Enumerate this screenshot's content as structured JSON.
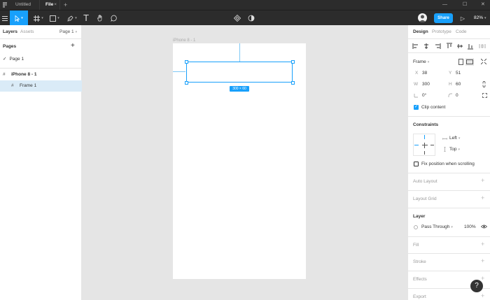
{
  "titlebar": {
    "tabs": [
      {
        "label": "Untitled"
      },
      {
        "label": "File",
        "close": "×"
      }
    ],
    "new_tab": "+",
    "window_controls": {
      "minimize": "—",
      "maximize": "☐",
      "close": "✕"
    }
  },
  "toolbar": {
    "text_tool": "T",
    "share_label": "Share",
    "zoom_label": "82%",
    "play_icon": "▷"
  },
  "left_panel": {
    "tabs": {
      "layers": "Layers",
      "assets": "Assets"
    },
    "page_selector": "Page 1",
    "pages_header": "Pages",
    "add_page": "+",
    "pages": [
      {
        "label": "Page 1",
        "check": "✓"
      }
    ],
    "layers": [
      {
        "label": "iPhone 8 - 1",
        "icon": "#"
      },
      {
        "label": "Frame 1",
        "icon": "#"
      }
    ]
  },
  "canvas": {
    "artboard_label": "iPhone 8 - 1",
    "size_badge": "300 × 60"
  },
  "right_panel": {
    "tabs": {
      "design": "Design",
      "prototype": "Prototype",
      "code": "Code"
    },
    "frame_label": "Frame",
    "x_label": "X",
    "x_value": "38",
    "y_label": "Y",
    "y_value": "51",
    "w_label": "W",
    "w_value": "300",
    "h_label": "H",
    "h_value": "60",
    "rotation_value": "0°",
    "radius_value": "0",
    "clip_content": "Clip content",
    "constraints_header": "Constraints",
    "h_constraint": "Left",
    "v_constraint": "Top",
    "fix_position": "Fix position when scrolling",
    "auto_layout": "Auto Layout",
    "layout_grid": "Layout Grid",
    "layer_header": "Layer",
    "blend_mode": "Pass Through",
    "opacity": "100%",
    "fill": "Fill",
    "stroke": "Stroke",
    "effects": "Effects",
    "export": "Export",
    "help": "?"
  },
  "colors": {
    "accent": "#18a0fb",
    "toolbar_bg": "#2c2c2c",
    "canvas_bg": "#e5e5e5",
    "selected_layer": "#daebf7"
  }
}
